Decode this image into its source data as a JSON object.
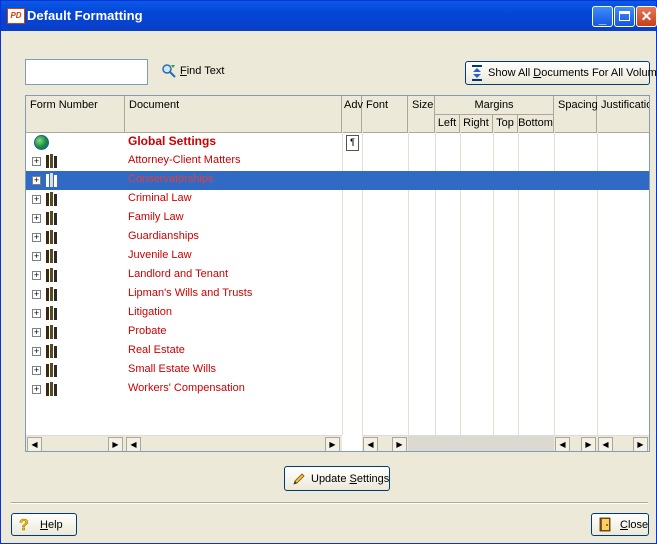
{
  "window": {
    "title": "Default Formatting",
    "app_icon_text": "PD"
  },
  "toolbar": {
    "find_input_value": "",
    "find_label": "Find Text",
    "find_mnemonic": "F",
    "find_rest": "ind Text",
    "show_all_pre": "Show All ",
    "show_all_mnemonic": "D",
    "show_all_post": "ocuments For All Volumes"
  },
  "grid": {
    "columns": {
      "form_number": "Form Number",
      "document": "Document",
      "adv": "Adv",
      "font": "Font",
      "size": "Size",
      "margins": "Margins",
      "left": "Left",
      "right": "Right",
      "top": "Top",
      "bottom": "Bottom",
      "spacing": "Spacing",
      "justification": "Justification"
    },
    "rows": [
      {
        "document": "Global Settings",
        "type": "global"
      },
      {
        "document": "Attorney-Client Matters",
        "type": "volume"
      },
      {
        "document": "Conservatorships",
        "type": "volume",
        "selected": true
      },
      {
        "document": "Criminal Law",
        "type": "volume"
      },
      {
        "document": "Family Law",
        "type": "volume"
      },
      {
        "document": "Guardianships",
        "type": "volume"
      },
      {
        "document": "Juvenile Law",
        "type": "volume"
      },
      {
        "document": "Landlord and Tenant",
        "type": "volume"
      },
      {
        "document": "Lipman's Wills and Trusts",
        "type": "volume"
      },
      {
        "document": "Litigation",
        "type": "volume"
      },
      {
        "document": "Probate",
        "type": "volume"
      },
      {
        "document": "Real Estate",
        "type": "volume"
      },
      {
        "document": "Small Estate Wills",
        "type": "volume"
      },
      {
        "document": "Workers' Compensation",
        "type": "volume"
      }
    ]
  },
  "buttons": {
    "update_pre": "Update ",
    "update_mnemonic": "S",
    "update_post": "ettings",
    "help_mnemonic": "H",
    "help_post": "elp",
    "close_mnemonic": "C",
    "close_post": "lose"
  },
  "colors": {
    "title_bar": "#0446d8",
    "selection": "#316ac5",
    "document_text": "#cc0000"
  }
}
